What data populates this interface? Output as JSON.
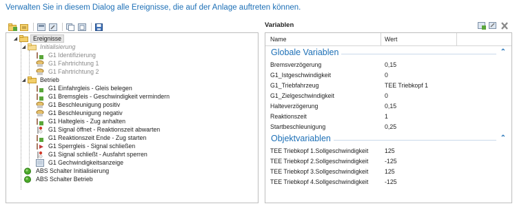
{
  "hint": "Verwalten Sie in diesem Dialog alle Ereignisse, die auf der Anlage auftreten können.",
  "toolbar": {
    "icons": [
      "new-folder-icon",
      "new-item-icon",
      "view-icon",
      "edit-icon",
      "copy-icon",
      "paste-icon",
      "save-icon"
    ]
  },
  "tree": {
    "root": "Ereignisse",
    "init": "Initialisierung",
    "init_items": [
      "G1 Identifizierung",
      "G1 Fahrtrichtung 1",
      "G1 Fahrtrichtung 2"
    ],
    "betrieb": "Betrieb",
    "betrieb_items": [
      "G1 Einfahrgleis - Gleis belegen",
      "G1 Bremsgleis - Geschwindigkeit vermindern",
      "G1 Beschleunigung positiv",
      "G1 Beschleunigung negativ",
      "G1 Haltegleis - Zug anhalten",
      "G1 Signal öffnet - Reaktionszeit abwarten",
      "G1 Reaktionszeit Ende - Zug starten",
      "G1 Sperrgleis - Signal schließen",
      "G1 Signal schließt - Ausfahrt sperren",
      "G1 Gechwindigkeitsanzeige"
    ],
    "abs_items": [
      "ABS Schalter Initialisierung",
      "ABS Schalter Betrieb"
    ]
  },
  "variables": {
    "title": "Variablen",
    "col_name": "Name",
    "col_value": "Wert",
    "global_title": "Globale Variablen",
    "object_title": "Objektvariablen",
    "global": [
      {
        "name": "Bremsverzögerung",
        "value": "0,15"
      },
      {
        "name": "G1_Istgeschwindigkeit",
        "value": "0"
      },
      {
        "name": "G1_Triebfahrzeug",
        "value": "TEE Triebkopf 1"
      },
      {
        "name": "G1_Zielgeschwindigkeit",
        "value": "0"
      },
      {
        "name": "Halteverzögerung",
        "value": "0,15"
      },
      {
        "name": "Reaktionszeit",
        "value": "1"
      },
      {
        "name": "Startbeschleunigung",
        "value": "0,25"
      }
    ],
    "object": [
      {
        "name": "TEE Triebkopf 1.Sollgeschwindigkeit",
        "value": "125"
      },
      {
        "name": "TEE Triebkopf 2.Sollgeschwindigkeit",
        "value": "-125"
      },
      {
        "name": "TEE Triebkopf 3.Sollgeschwindigkeit",
        "value": "125"
      },
      {
        "name": "TEE Triebkopf 4.Sollgeschwindigkeit",
        "value": "-125"
      }
    ]
  },
  "colors": {
    "accent": "#1c6fb6",
    "border": "#bdbdbd"
  }
}
